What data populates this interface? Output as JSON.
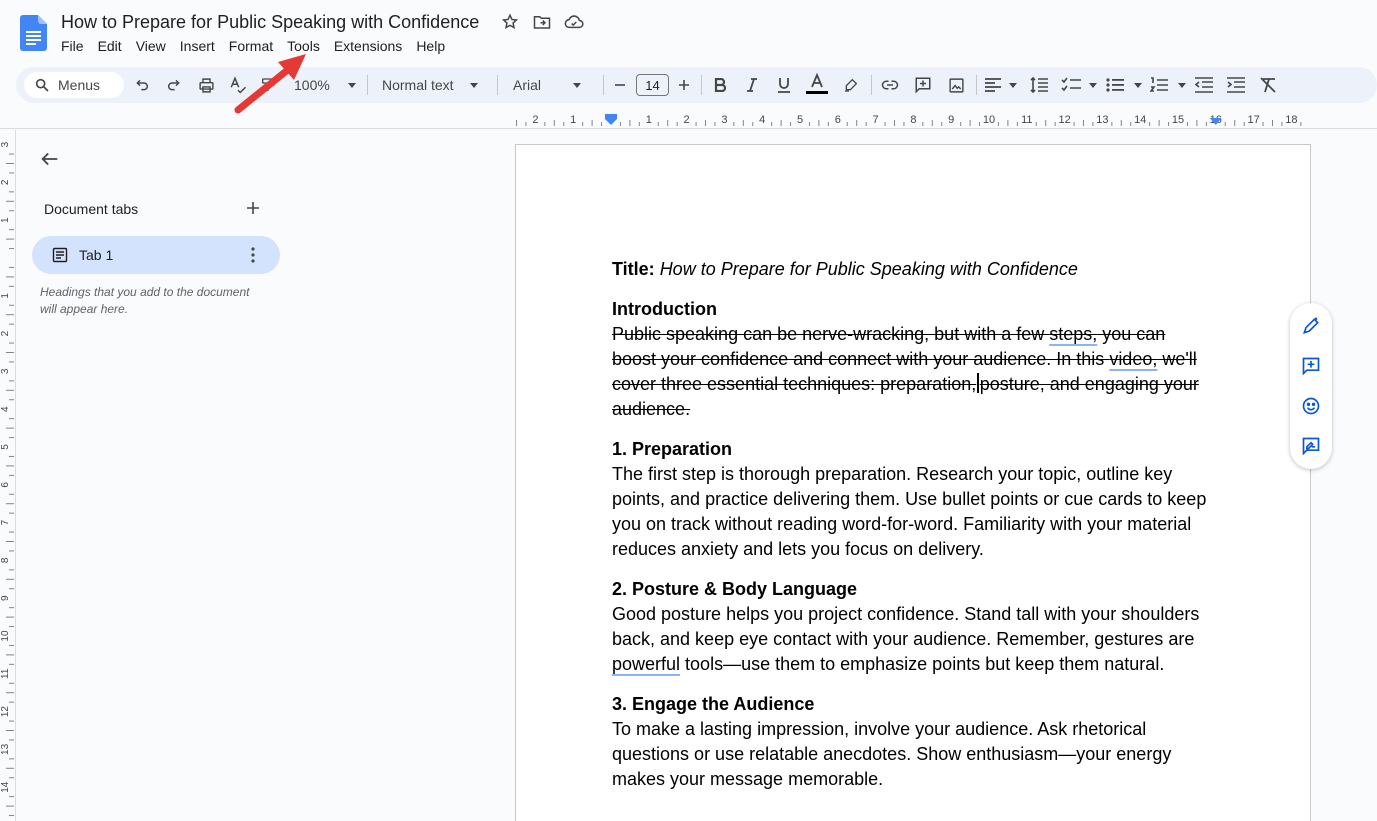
{
  "document": {
    "title": "How to Prepare for Public Speaking with Confidence"
  },
  "menu": {
    "items": [
      "File",
      "Edit",
      "View",
      "Insert",
      "Format",
      "Tools",
      "Extensions",
      "Help"
    ]
  },
  "toolbar": {
    "search_label": "Menus",
    "zoom": "100%",
    "style": "Normal text",
    "font": "Arial",
    "font_size": "14"
  },
  "ruler": {
    "labels": [
      "2",
      "1",
      "1",
      "2",
      "3",
      "4",
      "5",
      "6",
      "7",
      "8",
      "9",
      "10",
      "11",
      "12",
      "13",
      "14",
      "15",
      "16",
      "17",
      "18"
    ]
  },
  "sidebar": {
    "heading": "Document tabs",
    "tab_label": "Tab 1",
    "hint": "Headings that you add to the document will appear here."
  },
  "content": {
    "title_label": "Title:",
    "title_text": "How to Prepare for Public Speaking with Confidence",
    "intro_heading": "Introduction",
    "intro_part1": "Public speaking can be nerve-wracking, but with a few ",
    "intro_part2": "steps,",
    "intro_part3": " you can boost your confidence and connect with your audience. In this ",
    "intro_part4": "video,",
    "intro_part5": " we'll cover three essential techniques: preparation,",
    "intro_part6": "posture, and engaging your audience.",
    "s1_heading": "1. Preparation",
    "s1_text": "The first step is thorough preparation. Research your topic, outline key points, and practice delivering them. Use bullet points or cue cards to keep you on track without reading word-for-word. Familiarity with your material reduces anxiety and lets you focus on delivery.",
    "s2_heading": "2. Posture & Body Language",
    "s2_part1": "Good posture helps you project confidence. Stand tall with your shoulders back, and keep eye contact with your audience. Remember, gestures are ",
    "s2_part2": "powerful",
    "s2_part3": " tools—use them to emphasize points but keep them natural.",
    "s3_heading": "3. Engage the Audience",
    "s3_text": "To make a lasting impression, involve your audience. Ask rhetorical questions or use relatable anecdotes. Show enthusiasm—your energy makes your message memorable."
  },
  "colors": {
    "accent": "#0b57d0",
    "toolbar_bg": "#edf2fa",
    "tab_active": "#d3e3fd",
    "annotation_arrow": "#e53935"
  }
}
